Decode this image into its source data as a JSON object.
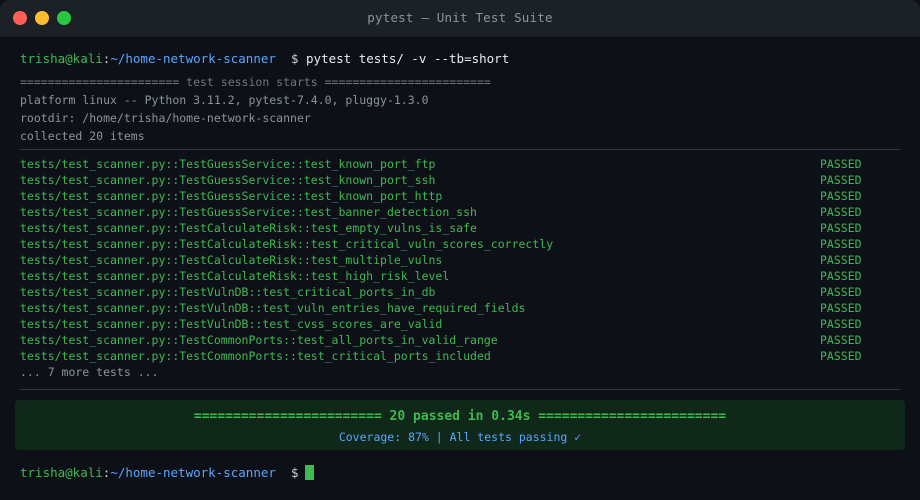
{
  "window": {
    "title": "pytest — Unit Test Suite"
  },
  "prompt": {
    "user_host": "trisha@kali",
    "colon": ":",
    "path": "~/home-network-scanner",
    "dollar": "$",
    "command": "pytest tests/ -v --tb=short"
  },
  "session": {
    "header": "======================= test session starts ========================",
    "platform": "platform linux -- Python 3.11.2, pytest-7.4.0, pluggy-1.3.0",
    "rootdir": "rootdir: /home/trisha/home-network-scanner",
    "collected": "collected 20 items"
  },
  "tests": [
    {
      "name": "tests/test_scanner.py::TestGuessService::test_known_port_ftp",
      "status": "PASSED"
    },
    {
      "name": "tests/test_scanner.py::TestGuessService::test_known_port_ssh",
      "status": "PASSED"
    },
    {
      "name": "tests/test_scanner.py::TestGuessService::test_known_port_http",
      "status": "PASSED"
    },
    {
      "name": "tests/test_scanner.py::TestGuessService::test_banner_detection_ssh",
      "status": "PASSED"
    },
    {
      "name": "tests/test_scanner.py::TestCalculateRisk::test_empty_vulns_is_safe",
      "status": "PASSED"
    },
    {
      "name": "tests/test_scanner.py::TestCalculateRisk::test_critical_vuln_scores_correctly",
      "status": "PASSED"
    },
    {
      "name": "tests/test_scanner.py::TestCalculateRisk::test_multiple_vulns",
      "status": "PASSED"
    },
    {
      "name": "tests/test_scanner.py::TestCalculateRisk::test_high_risk_level",
      "status": "PASSED"
    },
    {
      "name": "tests/test_scanner.py::TestVulnDB::test_critical_ports_in_db",
      "status": "PASSED"
    },
    {
      "name": "tests/test_scanner.py::TestVulnDB::test_vuln_entries_have_required_fields",
      "status": "PASSED"
    },
    {
      "name": "tests/test_scanner.py::TestVulnDB::test_cvss_scores_are_valid",
      "status": "PASSED"
    },
    {
      "name": "tests/test_scanner.py::TestCommonPorts::test_all_ports_in_valid_range",
      "status": "PASSED"
    },
    {
      "name": "tests/test_scanner.py::TestCommonPorts::test_critical_ports_included",
      "status": "PASSED"
    }
  ],
  "more_tests": "... 7 more tests ...",
  "summary": {
    "result": "======================== 20 passed in 0.34s ========================",
    "coverage": "Coverage: 87% | All tests passing ✓"
  },
  "colors": {
    "pass": "#3fb950",
    "path": "#58a6ff",
    "background": "#0d1117"
  }
}
